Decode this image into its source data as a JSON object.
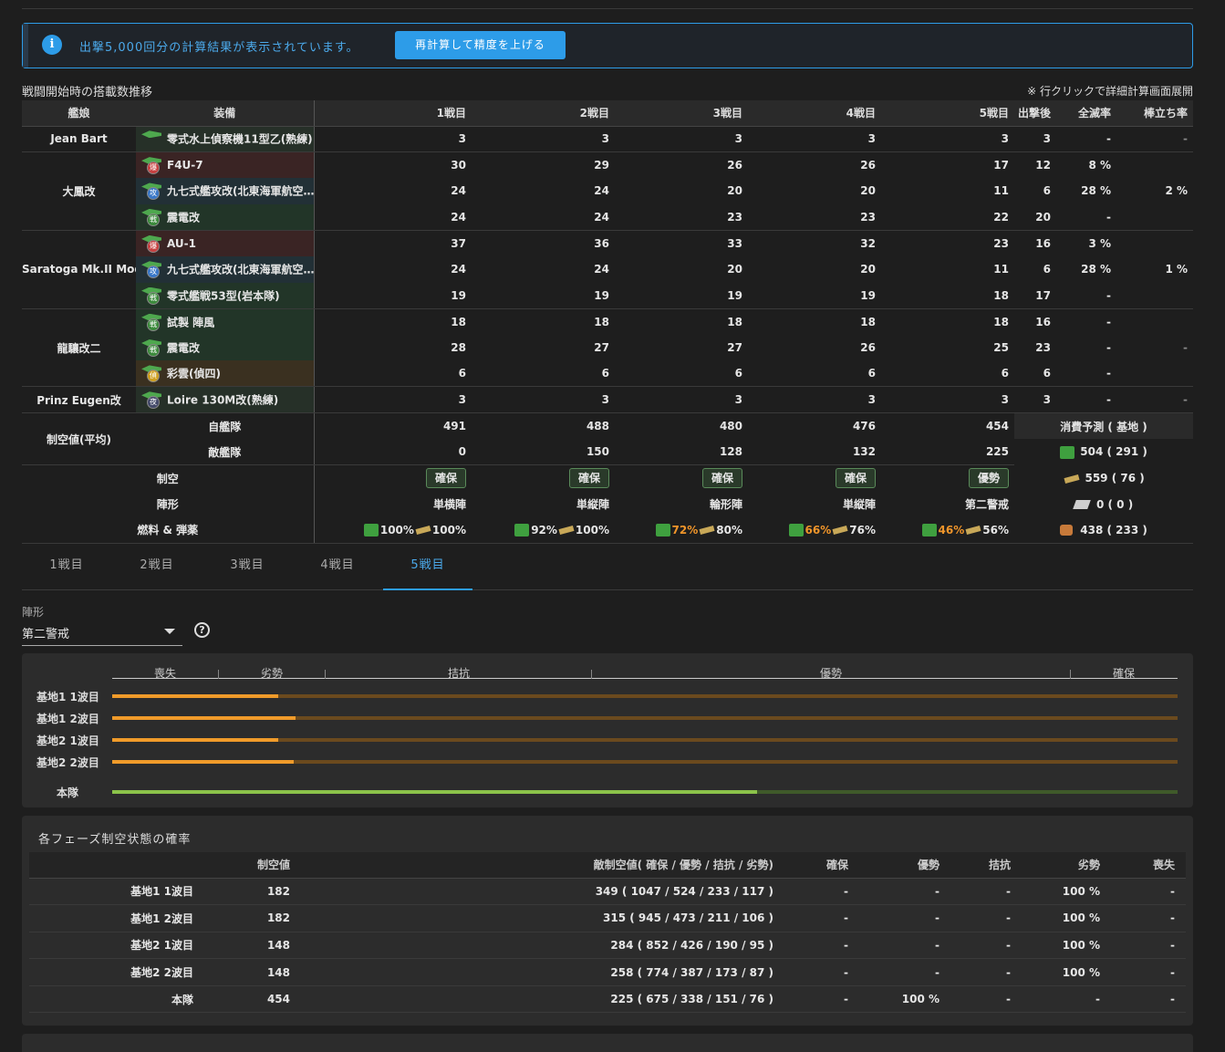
{
  "alert": {
    "message": "出撃5,000回分の計算結果が表示されています。",
    "button": "再計算して精度を上げる"
  },
  "section": {
    "title": "戦闘開始時の搭載数推移",
    "note": "※ 行クリックで詳細計算画面展開"
  },
  "headers": {
    "ship": "艦娘",
    "equipment": "装備",
    "battles": [
      "1戦目",
      "2戦目",
      "3戦目",
      "4戦目",
      "5戦目"
    ],
    "after": "出撃後",
    "annihilation": "全滅率",
    "idle": "棒立ち率"
  },
  "ships": [
    {
      "name": "Jean Bart",
      "idle": "-",
      "items": [
        {
          "name": "零式水上偵察機11型乙(熟練)",
          "badge": "",
          "color": "gray",
          "slots": [
            "3",
            "3",
            "3",
            "3",
            "3"
          ],
          "after": "3",
          "ann": "-"
        }
      ]
    },
    {
      "name": "大鳳改",
      "idle": "2 %",
      "items": [
        {
          "name": "F4U-7",
          "badge": "爆",
          "color": "red",
          "slots": [
            "30",
            "29",
            "26",
            "26",
            "17"
          ],
          "after": "12",
          "ann": "8 %"
        },
        {
          "name": "九七式艦攻改(北東海軍航空…",
          "badge": "攻",
          "color": "blue",
          "slots": [
            "24",
            "24",
            "20",
            "20",
            "11"
          ],
          "after": "6",
          "ann": "28 %"
        },
        {
          "name": "震電改",
          "badge": "戦",
          "color": "green",
          "slots": [
            "24",
            "24",
            "23",
            "23",
            "22"
          ],
          "after": "20",
          "ann": "-"
        }
      ]
    },
    {
      "name": "Saratoga Mk.II Mod.2",
      "idle": "1 %",
      "items": [
        {
          "name": "AU-1",
          "badge": "爆",
          "color": "red",
          "slots": [
            "37",
            "36",
            "33",
            "32",
            "23"
          ],
          "after": "16",
          "ann": "3 %"
        },
        {
          "name": "九七式艦攻改(北東海軍航空…",
          "badge": "攻",
          "color": "blue",
          "slots": [
            "24",
            "24",
            "20",
            "20",
            "11"
          ],
          "after": "6",
          "ann": "28 %"
        },
        {
          "name": "零式艦戦53型(岩本隊)",
          "badge": "戦",
          "color": "green",
          "slots": [
            "19",
            "19",
            "19",
            "19",
            "18"
          ],
          "after": "17",
          "ann": "-"
        }
      ]
    },
    {
      "name": "龍驤改二",
      "idle": "-",
      "items": [
        {
          "name": "試製 陣風",
          "badge": "戦",
          "color": "green",
          "slots": [
            "18",
            "18",
            "18",
            "18",
            "18"
          ],
          "after": "16",
          "ann": "-"
        },
        {
          "name": "震電改",
          "badge": "戦",
          "color": "green",
          "slots": [
            "28",
            "27",
            "27",
            "26",
            "25"
          ],
          "after": "23",
          "ann": "-"
        },
        {
          "name": "彩雲(偵四)",
          "badge": "偵",
          "color": "orange",
          "slots": [
            "6",
            "6",
            "6",
            "6",
            "6"
          ],
          "after": "6",
          "ann": "-"
        }
      ]
    },
    {
      "name": "Prinz Eugen改",
      "idle": "-",
      "items": [
        {
          "name": "Loire 130M改(熟練)",
          "badge": "夜",
          "color": "gray",
          "slots": [
            "3",
            "3",
            "3",
            "3",
            "3"
          ],
          "after": "3",
          "ann": "-"
        }
      ]
    }
  ],
  "air_power": {
    "label": "制空値(平均)",
    "own_label": "自艦隊",
    "own": [
      "491",
      "488",
      "480",
      "476",
      "454"
    ],
    "enemy_label": "敵艦隊",
    "enemy": [
      "0",
      "150",
      "128",
      "132",
      "225"
    ]
  },
  "air_state": {
    "label": "制空",
    "values": [
      "確保",
      "確保",
      "確保",
      "確保",
      "優勢"
    ]
  },
  "formation": {
    "label": "陣形",
    "values": [
      "単横陣",
      "単縦陣",
      "輪形陣",
      "単縦陣",
      "第二警戒"
    ]
  },
  "supplies": {
    "label": "燃料 & 弾薬",
    "fuel": [
      "100%",
      "92%",
      "72%",
      "66%",
      "46%"
    ],
    "ammo": [
      "100%",
      "100%",
      "80%",
      "76%",
      "56%"
    ],
    "fuel_low": [
      false,
      false,
      true,
      true,
      true
    ]
  },
  "consumption": {
    "title": "消費予測 ( 基地 )",
    "fuel": "504 ( 291 )",
    "ammo": "559 ( 76 )",
    "steel": "0 ( 0 )",
    "bauxite": "438 ( 233 )"
  },
  "tabs": [
    "1戦目",
    "2戦目",
    "3戦目",
    "4戦目",
    "5戦目"
  ],
  "active_tab": 4,
  "form": {
    "label": "陣形",
    "value": "第二警戒",
    "help": "?"
  },
  "scale": {
    "labels": [
      "喪失",
      "劣勢",
      "拮抗",
      "優勢",
      "確保"
    ]
  },
  "bars": [
    {
      "label": "基地1 1波目",
      "fill": 0.156
    },
    {
      "label": "基地1 2波目",
      "fill": 0.172
    },
    {
      "label": "基地2 1波目",
      "fill": 0.156
    },
    {
      "label": "基地2 2波目",
      "fill": 0.17
    },
    {
      "label": "本隊",
      "fill": 0.605,
      "main": true
    }
  ],
  "prob": {
    "title": "各フェーズ制空状態の確率",
    "headers": [
      "",
      "制空値",
      "敵制空値( 確保 / 優勢 / 拮抗 / 劣勢)",
      "確保",
      "優勢",
      "拮抗",
      "劣勢",
      "喪失"
    ],
    "rows": [
      [
        "基地1 1波目",
        "182",
        "349 ( 1047 / 524 / 233 / 117 )",
        "-",
        "-",
        "-",
        "100 %",
        "-"
      ],
      [
        "基地1 2波目",
        "182",
        "315 ( 945 / 473 / 211 / 106 )",
        "-",
        "-",
        "-",
        "100 %",
        "-"
      ],
      [
        "基地2 1波目",
        "148",
        "284 ( 852 / 426 / 190 / 95 )",
        "-",
        "-",
        "-",
        "100 %",
        "-"
      ],
      [
        "基地2 2波目",
        "148",
        "258 ( 774 / 387 / 173 / 87 )",
        "-",
        "-",
        "-",
        "100 %",
        "-"
      ],
      [
        "本隊",
        "454",
        "225 ( 675 / 338 / 151 / 76 )",
        "-",
        "100 %",
        "-",
        "-",
        "-"
      ]
    ]
  }
}
